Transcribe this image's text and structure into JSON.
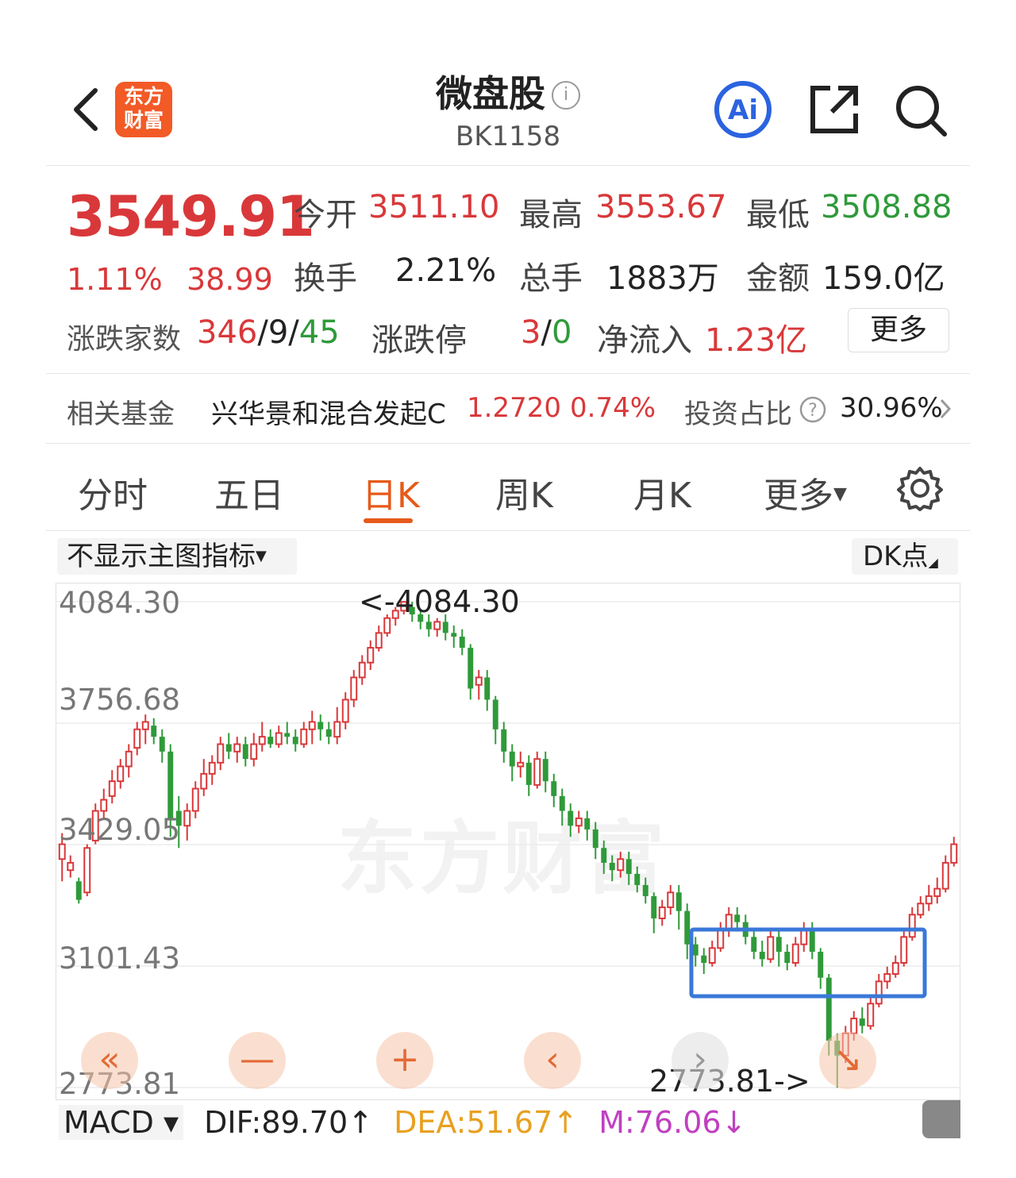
{
  "header": {
    "logo_line1": "东方",
    "logo_line2": "财富",
    "title": "微盘股",
    "info_icon": "i",
    "code": "BK1158",
    "ai_label": "Ai"
  },
  "quote": {
    "price": "3549.91",
    "change_pct": "1.11%",
    "change_abs": "38.99",
    "open_label": "今开",
    "open": "3511.10",
    "high_label": "最高",
    "high": "3553.67",
    "low_label": "最低",
    "low": "3508.88",
    "turnover_label": "换手",
    "turnover": "2.21%",
    "volume_label": "总手",
    "volume": "1883万",
    "amount_label": "金额",
    "amount": "159.0亿",
    "breadth_label": "涨跌家数",
    "breadth_up": "346",
    "breadth_flat": "9",
    "breadth_down": "45",
    "limit_label": "涨跌停",
    "limit_up": "3",
    "limit_down": "0",
    "inflow_label": "净流入",
    "inflow": "1.23亿",
    "more_button": "更多"
  },
  "fund": {
    "label": "相关基金",
    "name": "兴华景和混合发起C",
    "nav": "1.2720",
    "pct": "0.74%",
    "ratio_label": "投资占比",
    "ratio": "30.96%"
  },
  "tabs": [
    "分时",
    "五日",
    "日K",
    "周K",
    "月K",
    "更多"
  ],
  "active_tab": "日K",
  "chart_controls": {
    "indicator_select": "不显示主图指标",
    "dk_button": "DK点"
  },
  "chart_data": {
    "type": "candlestick",
    "y_ticks": [
      "4084.30",
      "3756.68",
      "3429.05",
      "3101.43",
      "2773.81"
    ],
    "ylim": [
      2773.81,
      4084.3
    ],
    "max_label": "<-4084.30",
    "min_label": "2773.81->",
    "watermark": "东方财富",
    "grid": true,
    "colors": {
      "up": "#d9383a",
      "down": "#2f9a3a",
      "box": "#3a78d8"
    },
    "highlight_box": {
      "y_top": 3146,
      "y_bottom": 3130
    },
    "candles": [
      [
        3390,
        3430,
        3330,
        3460
      ],
      [
        3360,
        3380,
        3340,
        3400
      ],
      [
        3330,
        3280,
        3270,
        3340
      ],
      [
        3300,
        3420,
        3290,
        3430
      ],
      [
        3440,
        3520,
        3430,
        3540
      ],
      [
        3520,
        3550,
        3500,
        3580
      ],
      [
        3560,
        3600,
        3540,
        3630
      ],
      [
        3600,
        3640,
        3580,
        3660
      ],
      [
        3640,
        3680,
        3610,
        3700
      ],
      [
        3690,
        3740,
        3670,
        3760
      ],
      [
        3740,
        3760,
        3700,
        3780
      ],
      [
        3750,
        3720,
        3700,
        3770
      ],
      [
        3720,
        3680,
        3650,
        3740
      ],
      [
        3680,
        3500,
        3450,
        3700
      ],
      [
        3520,
        3480,
        3420,
        3560
      ],
      [
        3480,
        3520,
        3440,
        3540
      ],
      [
        3520,
        3580,
        3500,
        3600
      ],
      [
        3580,
        3620,
        3560,
        3660
      ],
      [
        3620,
        3650,
        3590,
        3670
      ],
      [
        3650,
        3700,
        3630,
        3720
      ],
      [
        3700,
        3680,
        3660,
        3730
      ],
      [
        3680,
        3700,
        3650,
        3720
      ],
      [
        3700,
        3660,
        3640,
        3720
      ],
      [
        3660,
        3700,
        3640,
        3730
      ],
      [
        3700,
        3720,
        3680,
        3760
      ],
      [
        3720,
        3700,
        3690,
        3740
      ],
      [
        3700,
        3730,
        3690,
        3750
      ],
      [
        3730,
        3720,
        3700,
        3760
      ],
      [
        3720,
        3700,
        3680,
        3740
      ],
      [
        3700,
        3740,
        3690,
        3760
      ],
      [
        3740,
        3760,
        3700,
        3790
      ],
      [
        3760,
        3740,
        3710,
        3780
      ],
      [
        3740,
        3720,
        3700,
        3760
      ],
      [
        3720,
        3760,
        3700,
        3800
      ],
      [
        3760,
        3820,
        3740,
        3840
      ],
      [
        3820,
        3880,
        3800,
        3900
      ],
      [
        3880,
        3920,
        3860,
        3940
      ],
      [
        3920,
        3960,
        3900,
        3980
      ],
      [
        3960,
        4000,
        3950,
        4020
      ],
      [
        4000,
        4040,
        3990,
        4050
      ],
      [
        4040,
        4060,
        4020,
        4070
      ],
      [
        4060,
        4084,
        4050,
        4084
      ],
      [
        4070,
        4050,
        4030,
        4084
      ],
      [
        4050,
        4030,
        4010,
        4060
      ],
      [
        4030,
        4010,
        3990,
        4050
      ],
      [
        4010,
        4030,
        3990,
        4040
      ],
      [
        4030,
        4000,
        3980,
        4050
      ],
      [
        4000,
        3990,
        3960,
        4020
      ],
      [
        3990,
        3960,
        3940,
        4010
      ],
      [
        3960,
        3850,
        3820,
        3970
      ],
      [
        3860,
        3880,
        3820,
        3900
      ],
      [
        3880,
        3820,
        3790,
        3900
      ],
      [
        3820,
        3740,
        3700,
        3830
      ],
      [
        3740,
        3680,
        3650,
        3760
      ],
      [
        3680,
        3640,
        3600,
        3700
      ],
      [
        3640,
        3650,
        3610,
        3680
      ],
      [
        3650,
        3590,
        3560,
        3670
      ],
      [
        3590,
        3660,
        3580,
        3680
      ],
      [
        3660,
        3600,
        3570,
        3680
      ],
      [
        3600,
        3560,
        3530,
        3620
      ],
      [
        3560,
        3520,
        3480,
        3580
      ],
      [
        3520,
        3480,
        3450,
        3540
      ],
      [
        3480,
        3500,
        3460,
        3520
      ],
      [
        3500,
        3470,
        3440,
        3520
      ],
      [
        3470,
        3420,
        3390,
        3490
      ],
      [
        3420,
        3380,
        3350,
        3440
      ],
      [
        3380,
        3360,
        3330,
        3400
      ],
      [
        3360,
        3390,
        3340,
        3410
      ],
      [
        3390,
        3350,
        3320,
        3410
      ],
      [
        3350,
        3320,
        3300,
        3370
      ],
      [
        3320,
        3290,
        3270,
        3340
      ],
      [
        3290,
        3230,
        3190,
        3300
      ],
      [
        3230,
        3260,
        3210,
        3280
      ],
      [
        3260,
        3300,
        3240,
        3320
      ],
      [
        3300,
        3250,
        3200,
        3320
      ],
      [
        3250,
        3160,
        3120,
        3270
      ],
      [
        3160,
        3130,
        3100,
        3180
      ],
      [
        3130,
        3110,
        3080,
        3150
      ],
      [
        3110,
        3150,
        3100,
        3170
      ],
      [
        3150,
        3200,
        3140,
        3220
      ],
      [
        3200,
        3240,
        3180,
        3260
      ],
      [
        3240,
        3220,
        3200,
        3260
      ],
      [
        3220,
        3180,
        3160,
        3240
      ],
      [
        3180,
        3140,
        3120,
        3200
      ],
      [
        3140,
        3120,
        3100,
        3170
      ],
      [
        3120,
        3180,
        3110,
        3200
      ],
      [
        3180,
        3140,
        3100,
        3200
      ],
      [
        3140,
        3110,
        3090,
        3160
      ],
      [
        3110,
        3160,
        3100,
        3180
      ],
      [
        3160,
        3200,
        3140,
        3220
      ],
      [
        3200,
        3140,
        3120,
        3220
      ],
      [
        3140,
        3070,
        3040,
        3150
      ],
      [
        3070,
        2900,
        2860,
        3080
      ],
      [
        2900,
        2860,
        2773,
        2920
      ],
      [
        2860,
        2920,
        2840,
        2940
      ],
      [
        2920,
        2960,
        2900,
        2980
      ],
      [
        2960,
        2940,
        2920,
        2990
      ],
      [
        2940,
        3000,
        2930,
        3020
      ],
      [
        3000,
        3060,
        2990,
        3080
      ],
      [
        3060,
        3080,
        3040,
        3100
      ],
      [
        3080,
        3110,
        3070,
        3130
      ],
      [
        3110,
        3180,
        3100,
        3200
      ],
      [
        3180,
        3240,
        3170,
        3260
      ],
      [
        3240,
        3270,
        3230,
        3290
      ],
      [
        3270,
        3290,
        3250,
        3320
      ],
      [
        3290,
        3310,
        3270,
        3340
      ],
      [
        3310,
        3380,
        3300,
        3400
      ],
      [
        3380,
        3430,
        3370,
        3450
      ]
    ]
  },
  "nav_buttons": [
    "«",
    "—",
    "+",
    "‹",
    "›",
    "↘"
  ],
  "macd": {
    "select": "MACD ▾",
    "dif": "DIF:89.70↑",
    "dea": "DEA:51.67↑",
    "m": "M:76.06↓",
    "colors": {
      "dif": "#222222",
      "dea": "#e8a020",
      "m": "#c040c0"
    }
  }
}
